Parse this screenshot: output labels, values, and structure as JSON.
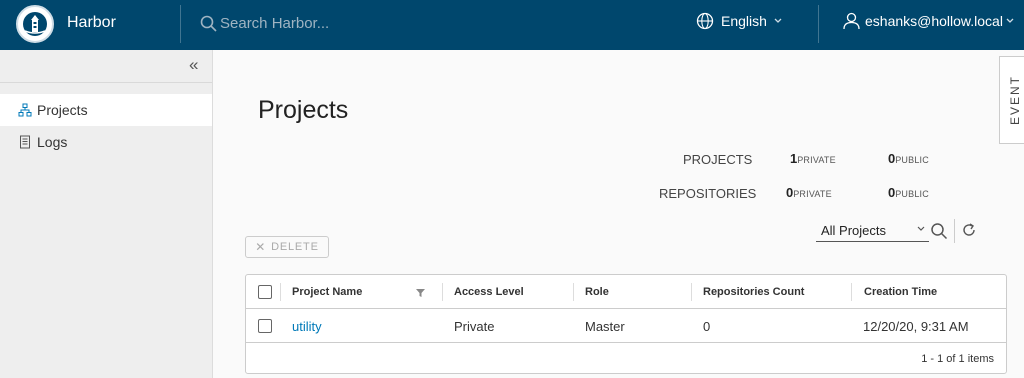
{
  "header": {
    "brand": "Harbor",
    "search_placeholder": "Search Harbor...",
    "language": "English",
    "user": "eshanks@hollow.local",
    "colors": {
      "bg": "#00476d",
      "text": "#ffffff"
    }
  },
  "sidebar": {
    "items": [
      {
        "label": "Projects",
        "icon": "projects-icon",
        "active": true
      },
      {
        "label": "Logs",
        "icon": "logs-icon",
        "active": false
      }
    ]
  },
  "main": {
    "title": "Projects",
    "event_tab": "EVENT",
    "summary": {
      "projects_label": "PROJECTS",
      "repositories_label": "REPOSITORIES",
      "projects_private": "1",
      "projects_public": "0",
      "repos_private": "0",
      "repos_public": "0",
      "private_label": "PRIVATE",
      "public_label": "PUBLIC"
    },
    "toolbar": {
      "delete_label": "DELETE",
      "filter_value": "All Projects"
    },
    "table": {
      "columns": [
        "Project Name",
        "Access Level",
        "Role",
        "Repositories Count",
        "Creation Time"
      ],
      "rows": [
        {
          "name": "utility",
          "access": "Private",
          "role": "Master",
          "repo_count": "0",
          "created": "12/20/20, 9:31 AM"
        }
      ],
      "footer": "1 - 1 of 1 items"
    },
    "colors": {
      "link": "#0079b8"
    }
  }
}
